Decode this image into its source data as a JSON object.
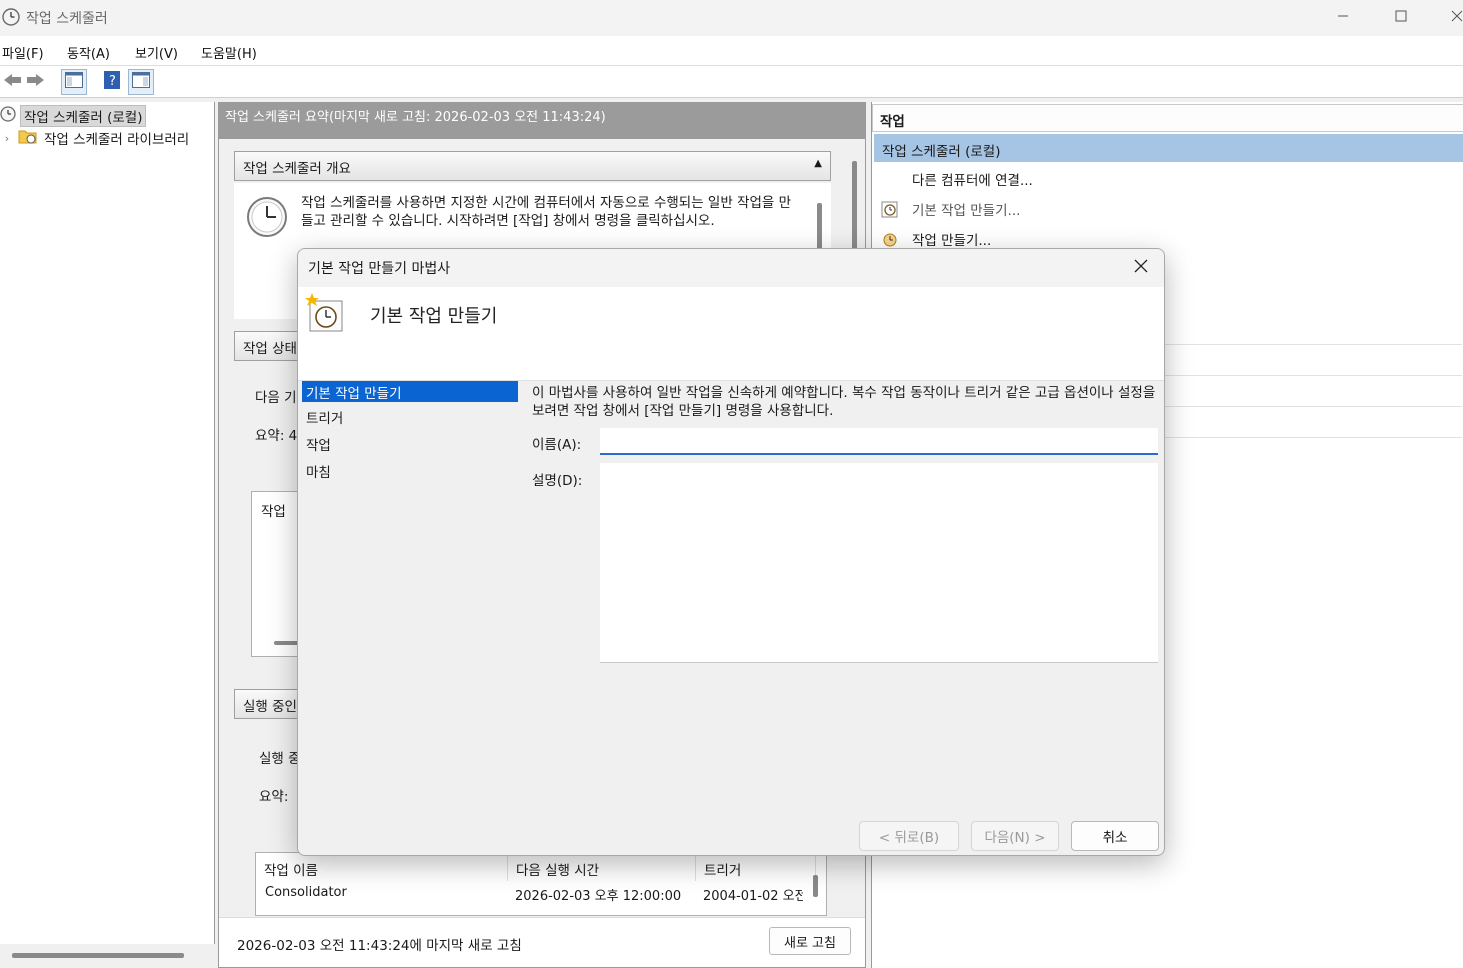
{
  "window": {
    "title": "작업 스케줄러",
    "minimize_icon": "minimize-icon",
    "maximize_icon": "maximize-icon",
    "close_icon": "close-icon"
  },
  "menu": [
    {
      "label": "파일(F)"
    },
    {
      "label": "동작(A)"
    },
    {
      "label": "보기(V)"
    },
    {
      "label": "도움말(H)"
    }
  ],
  "toolbar": {
    "icons": [
      "back-arrow-icon",
      "forward-arrow-icon",
      "show-hide-console-tree-icon",
      "help-icon",
      "show-hide-action-pane-icon"
    ]
  },
  "tree": {
    "root_label": "작업 스케줄러 (로컬)",
    "child_label": "작업 스케줄러 라이브러리"
  },
  "middle": {
    "header": "작업 스케줄러 요약(마지막 새로 고침: 2026-02-03 오전 11:43:24)",
    "overview_title": "작업 스케줄러 개요",
    "overview_text": "작업 스케줄러를 사용하면 지정한 시간에 컴퓨터에서 자동으로 수행되는 일반 작업을 만들고 관리할 수 있습니다. 시작하려면 [작업] 창에서 명령을 클릭하십시오.",
    "status_title": "작업 상태",
    "status_next": "다음 기",
    "status_summary": "요약: 4",
    "inner_box_label": "작업",
    "active_title": "실행 중인",
    "active_run": "실행 중",
    "active_summary": "요약:",
    "table": {
      "columns": [
        "작업 이름",
        "다음 실행 시간",
        "트리거"
      ],
      "rows": [
        [
          "Consolidator",
          "2026-02-03 오후 12:00:00",
          "2004-01-02 오전"
        ]
      ]
    },
    "footer_text": "2026-02-03 오전 11:43:24에 마지막 새로 고침",
    "refresh_label": "새로 고침"
  },
  "actions": {
    "title": "작업",
    "group": "작업 스케줄러 (로컬)",
    "items": [
      {
        "label": "다른 컴퓨터에 연결...",
        "icon": "none"
      },
      {
        "label": "기본 작업 만들기...",
        "icon": "basic-task-icon"
      },
      {
        "label": "작업 만들기...",
        "icon": "create-task-icon"
      }
    ]
  },
  "dialog": {
    "title": "기본 작업 만들기 마법사",
    "heading": "기본 작업 만들기",
    "steps": [
      "기본 작업 만들기",
      "트리거",
      "작업",
      "마침"
    ],
    "active_step": 0,
    "description": "이 마법사를 사용하여 일반 작업을 신속하게 예약합니다. 복수 작업 동작이나 트리거 같은 고급 옵션이나 설정을 보려면 작업 창에서 [작업 만들기] 명령을 사용합니다.",
    "name_label": "이름(A):",
    "name_value": "",
    "desc_label": "설명(D):",
    "desc_value": "",
    "back_label": "< 뒤로(B)",
    "next_label": "다음(N) >",
    "cancel_label": "취소"
  }
}
